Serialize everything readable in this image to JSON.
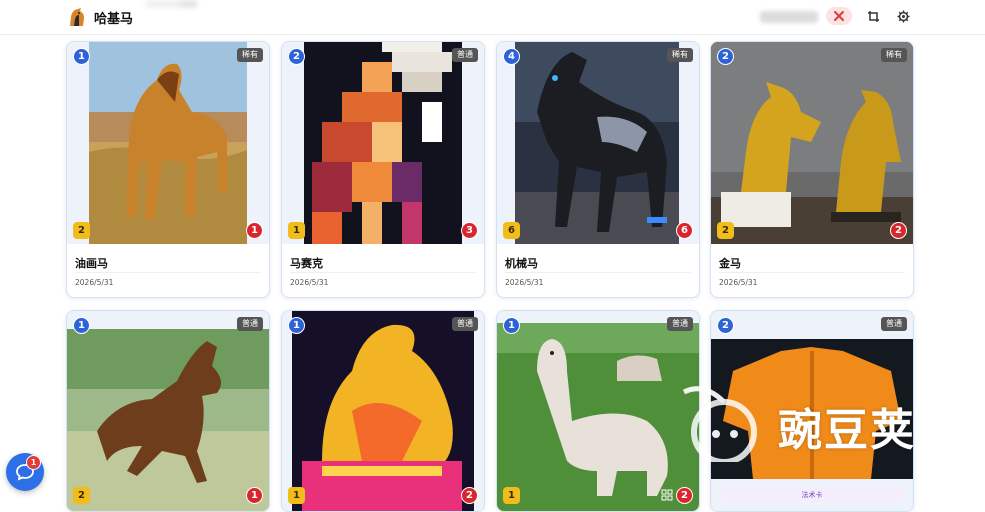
{
  "header": {
    "app_title": "哈基马",
    "icons": [
      "horse-logo-icon",
      "close-icon",
      "crop-icon",
      "gear-icon"
    ]
  },
  "cards": [
    {
      "index": "1",
      "tag": "稀有",
      "level": "2",
      "likes": "1",
      "title": "油画马",
      "date": "2026/5/31",
      "image": "oil-painting-horse"
    },
    {
      "index": "2",
      "tag": "普通",
      "level": "1",
      "likes": "3",
      "title": "马赛克",
      "date": "2026/5/31",
      "image": "pixel-mosaic-horse"
    },
    {
      "index": "4",
      "tag": "稀有",
      "level": "6",
      "likes": "6",
      "title": "机械马",
      "date": "2026/5/31",
      "image": "mechanical-horse"
    },
    {
      "index": "2",
      "tag": "稀有",
      "level": "2",
      "likes": "2",
      "title": "金马",
      "date": "2026/5/31",
      "image": "golden-horse-statues"
    },
    {
      "index": "1",
      "tag": "普通",
      "level": "2",
      "likes": "1",
      "image": "running-horse-painting"
    },
    {
      "index": "1",
      "tag": "普通",
      "level": "1",
      "likes": "2",
      "image": "lantern-horse"
    },
    {
      "index": "1",
      "tag": "普通",
      "level": "1",
      "likes": "2",
      "image": "alpaca"
    },
    {
      "index": "2",
      "tag": "普通",
      "pill": "法术卡",
      "image": "orange-robe"
    }
  ],
  "chat": {
    "badge": "1"
  },
  "watermark": {
    "text": "豌豆荚"
  },
  "colors": {
    "accent": "#2e63d8",
    "tag_bg": "#555555",
    "level_yellow": "#f1bd1b",
    "like_red": "#d9262e",
    "card_border": "#d3e1f3"
  }
}
